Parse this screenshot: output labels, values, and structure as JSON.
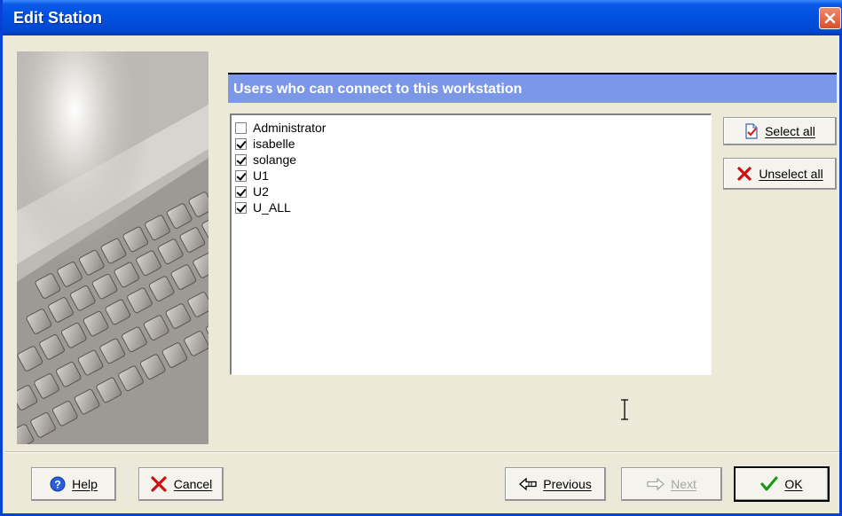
{
  "window": {
    "title": "Edit Station"
  },
  "group": {
    "header": "Users who can connect to this workstation"
  },
  "users": [
    {
      "name": "Administrator",
      "checked": false
    },
    {
      "name": "isabelle",
      "checked": true
    },
    {
      "name": "solange",
      "checked": true
    },
    {
      "name": "U1",
      "checked": true
    },
    {
      "name": "U2",
      "checked": true
    },
    {
      "name": "U_ALL",
      "checked": true
    }
  ],
  "side_buttons": {
    "select_all": {
      "label": "Select all",
      "icon": "document-check-icon"
    },
    "unselect_all": {
      "label": "Unselect all",
      "icon": "red-x-icon"
    }
  },
  "footer": {
    "help": {
      "label": "Help",
      "icon": "help-icon"
    },
    "cancel": {
      "label": "Cancel",
      "icon": "red-x-icon"
    },
    "previous": {
      "label": "Previous",
      "icon": "arrow-left-icon"
    },
    "next": {
      "label": "Next",
      "icon": "arrow-right-icon",
      "disabled": true
    },
    "ok": {
      "label": "OK",
      "icon": "checkmark-icon"
    }
  },
  "colors": {
    "titlebar": "#0050e0",
    "group_header": "#7b98e8",
    "close": "#d9502b"
  }
}
